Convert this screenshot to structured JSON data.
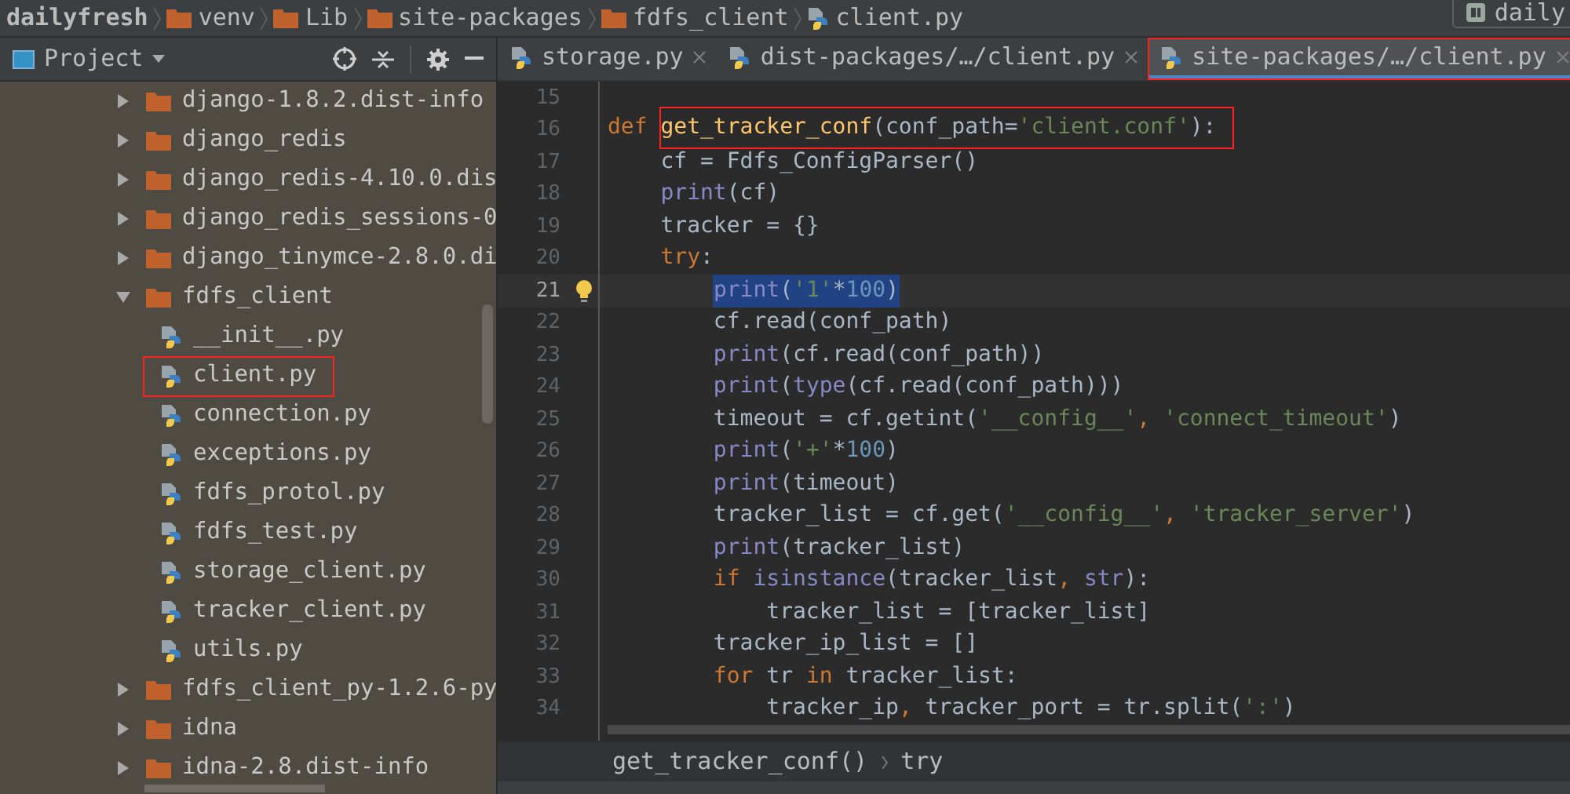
{
  "breadcrumb": [
    {
      "label": "dailyfresh",
      "kind": "project"
    },
    {
      "label": "venv",
      "kind": "folder"
    },
    {
      "label": "Lib",
      "kind": "folder"
    },
    {
      "label": "site-packages",
      "kind": "folder"
    },
    {
      "label": "fdfs_client",
      "kind": "folder"
    },
    {
      "label": "client.py",
      "kind": "python"
    }
  ],
  "run_config": {
    "label": "daily"
  },
  "project_panel": {
    "title": "Project",
    "tree": [
      {
        "label": "django-1.8.2.dist-info",
        "kind": "folder",
        "expanded": false
      },
      {
        "label": "django_redis",
        "kind": "folder",
        "expanded": false
      },
      {
        "label": "django_redis-4.10.0.dis",
        "kind": "folder",
        "expanded": false
      },
      {
        "label": "django_redis_sessions-0",
        "kind": "folder",
        "expanded": false
      },
      {
        "label": "django_tinymce-2.8.0.di",
        "kind": "folder",
        "expanded": false
      },
      {
        "label": "fdfs_client",
        "kind": "folder",
        "expanded": true,
        "children": [
          {
            "label": "__init__.py",
            "kind": "python",
            "marked": false
          },
          {
            "label": "client.py",
            "kind": "python",
            "marked": true
          },
          {
            "label": "connection.py",
            "kind": "python",
            "marked": false
          },
          {
            "label": "exceptions.py",
            "kind": "python",
            "marked": false
          },
          {
            "label": "fdfs_protol.py",
            "kind": "python",
            "marked": false
          },
          {
            "label": "fdfs_test.py",
            "kind": "python",
            "marked": false
          },
          {
            "label": "storage_client.py",
            "kind": "python",
            "marked": false
          },
          {
            "label": "tracker_client.py",
            "kind": "python",
            "marked": false
          },
          {
            "label": "utils.py",
            "kind": "python",
            "marked": false
          }
        ]
      },
      {
        "label": "fdfs_client_py-1.2.6-py",
        "kind": "folder",
        "expanded": false
      },
      {
        "label": "idna",
        "kind": "folder",
        "expanded": false
      },
      {
        "label": "idna-2.8.dist-info",
        "kind": "folder",
        "expanded": false
      }
    ]
  },
  "tabs": [
    {
      "label": "storage.py",
      "selected": false,
      "marked": false
    },
    {
      "label": "dist-packages/…/client.py",
      "selected": false,
      "marked": false
    },
    {
      "label": "site-packages/…/client.py",
      "selected": true,
      "marked": true
    }
  ],
  "code": [
    {
      "number": "15",
      "current": false
    },
    {
      "number": "16",
      "current": false,
      "tokens": [
        {
          "t": "def ",
          "kind": "kw"
        },
        {
          "t": "get_tracker_conf",
          "kind": "fn",
          "marked": true
        },
        {
          "t": "(conf_path=",
          "kind": "plain"
        },
        {
          "t": "'client.conf'",
          "kind": "str"
        },
        {
          "t": "):",
          "kind": "plain"
        }
      ]
    },
    {
      "number": "17",
      "current": false,
      "tokens": [
        {
          "t": "    cf = Fdfs_ConfigParser()",
          "kind": "plain"
        }
      ]
    },
    {
      "number": "18",
      "current": false,
      "tokens": [
        {
          "t": "    print",
          "kind": "builtin"
        },
        {
          "t": "(cf)",
          "kind": "plain"
        }
      ]
    },
    {
      "number": "19",
      "current": false,
      "tokens": [
        {
          "t": "    tracker = {}",
          "kind": "plain"
        }
      ]
    },
    {
      "number": "20",
      "current": false,
      "tokens": [
        {
          "t": "    try",
          "kind": "kw"
        },
        {
          "t": ":",
          "kind": "plain"
        }
      ]
    },
    {
      "number": "21",
      "current": true,
      "tokens": [
        {
          "t": "print",
          "kind": "builtin",
          "selected": true
        },
        {
          "t": "(",
          "kind": "plain",
          "selected": true
        },
        {
          "t": "'1'",
          "kind": "str",
          "selected": true
        },
        {
          "t": "*",
          "kind": "plain",
          "selected": true
        },
        {
          "t": "100",
          "kind": "num",
          "selected": true
        },
        {
          "t": ")",
          "kind": "plain",
          "selected": true
        }
      ]
    },
    {
      "number": "22",
      "current": false,
      "tokens": [
        {
          "t": "        cf.read(conf_path)",
          "kind": "plain"
        }
      ]
    },
    {
      "number": "23",
      "current": false,
      "tokens": [
        {
          "t": "        print",
          "kind": "builtin"
        },
        {
          "t": "(cf.read(conf_path))",
          "kind": "plain"
        }
      ]
    },
    {
      "number": "24",
      "current": false,
      "tokens": [
        {
          "t": "        print",
          "kind": "builtin"
        },
        {
          "t": "(",
          "kind": "plain"
        },
        {
          "t": "type",
          "kind": "builtin"
        },
        {
          "t": "(cf.read(conf_path)))",
          "kind": "plain"
        }
      ]
    },
    {
      "number": "25",
      "current": false,
      "tokens": [
        {
          "t": "        timeout = cf.getint(",
          "kind": "plain"
        },
        {
          "t": "'__config__'",
          "kind": "str"
        },
        {
          "t": ", ",
          "kind": "kw"
        },
        {
          "t": "'connect_timeout'",
          "kind": "str"
        },
        {
          "t": ")",
          "kind": "plain"
        }
      ]
    },
    {
      "number": "26",
      "current": false,
      "tokens": [
        {
          "t": "        print",
          "kind": "builtin"
        },
        {
          "t": "(",
          "kind": "plain"
        },
        {
          "t": "'+'",
          "kind": "str"
        },
        {
          "t": "*",
          "kind": "plain"
        },
        {
          "t": "100",
          "kind": "num"
        },
        {
          "t": ")",
          "kind": "plain"
        }
      ]
    },
    {
      "number": "27",
      "current": false,
      "tokens": [
        {
          "t": "        print",
          "kind": "builtin"
        },
        {
          "t": "(timeout)",
          "kind": "plain"
        }
      ]
    },
    {
      "number": "28",
      "current": false,
      "tokens": [
        {
          "t": "        tracker_list = cf.get(",
          "kind": "plain"
        },
        {
          "t": "'__config__'",
          "kind": "str"
        },
        {
          "t": ", ",
          "kind": "kw"
        },
        {
          "t": "'tracker_server'",
          "kind": "str"
        },
        {
          "t": ")",
          "kind": "plain"
        }
      ]
    },
    {
      "number": "29",
      "current": false,
      "tokens": [
        {
          "t": "        print",
          "kind": "builtin"
        },
        {
          "t": "(tracker_list)",
          "kind": "plain"
        }
      ]
    },
    {
      "number": "30",
      "current": false,
      "tokens": [
        {
          "t": "        if ",
          "kind": "kw"
        },
        {
          "t": "isinstance",
          "kind": "builtin"
        },
        {
          "t": "(tracker_list",
          "kind": "plain"
        },
        {
          "t": ", ",
          "kind": "kw"
        },
        {
          "t": "str",
          "kind": "builtin"
        },
        {
          "t": "):",
          "kind": "plain"
        }
      ]
    },
    {
      "number": "31",
      "current": false,
      "tokens": [
        {
          "t": "            tracker_list = [tracker_list]",
          "kind": "plain"
        }
      ]
    },
    {
      "number": "32",
      "current": false,
      "tokens": [
        {
          "t": "        tracker_ip_list = []",
          "kind": "plain"
        }
      ]
    },
    {
      "number": "33",
      "current": false,
      "tokens": [
        {
          "t": "        for ",
          "kind": "kw"
        },
        {
          "t": "tr ",
          "kind": "plain"
        },
        {
          "t": "in ",
          "kind": "kw"
        },
        {
          "t": "tracker_list:",
          "kind": "plain"
        }
      ]
    },
    {
      "number": "34",
      "current": false,
      "tokens": [
        {
          "t": "            tracker_ip",
          "kind": "plain"
        },
        {
          "t": ", ",
          "kind": "kw"
        },
        {
          "t": "tracker_port = tr.split(",
          "kind": "plain"
        },
        {
          "t": "':'",
          "kind": "str"
        },
        {
          "t": ")",
          "kind": "plain"
        }
      ]
    }
  ],
  "structure_path": [
    "get_tracker_conf()",
    "try"
  ]
}
